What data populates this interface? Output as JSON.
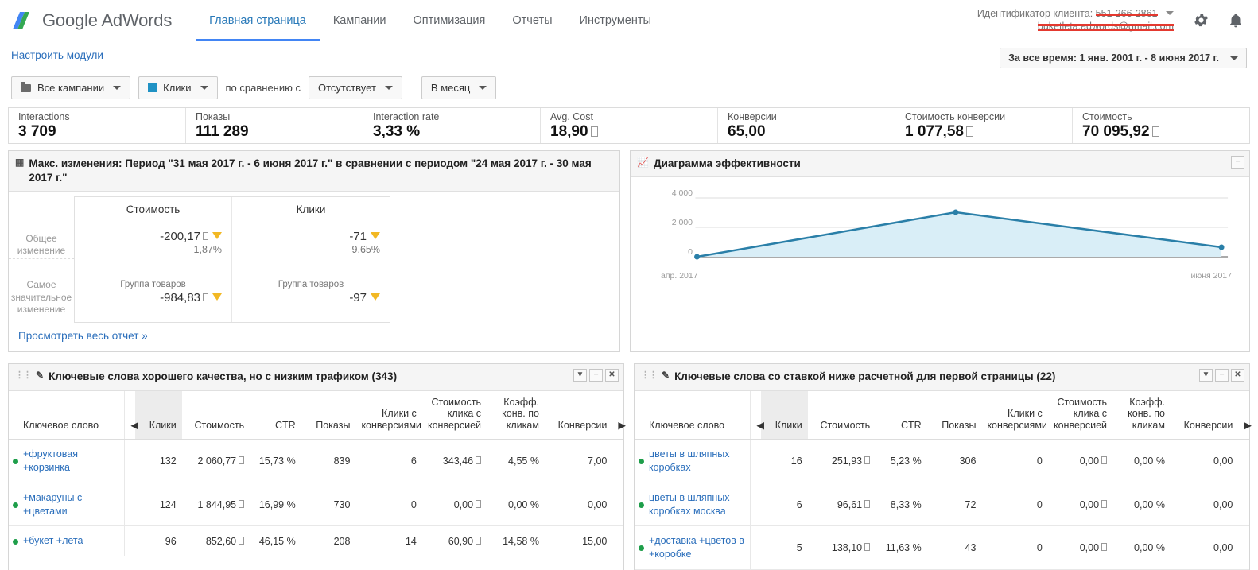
{
  "header": {
    "brand": "Google AdWords",
    "brand_google": "Google",
    "brand_adwords": "AdWords",
    "nav": [
      {
        "label": "Главная страница",
        "active": true
      },
      {
        "label": "Кампании",
        "active": false
      },
      {
        "label": "Оптимизация",
        "active": false
      },
      {
        "label": "Отчеты",
        "active": false
      },
      {
        "label": "Инструменты",
        "active": false
      }
    ],
    "client_label": "Идентификатор клиента:",
    "client_id": "551-266-2861",
    "client_email": "buketleta.adwords@gmail.com",
    "gear_icon": "gear-icon",
    "bell_icon": "bell-icon"
  },
  "subbar": {
    "configure_modules": "Настроить модули",
    "date_range": "За все время: 1 янв. 2001 г. - 8 июня 2017 г."
  },
  "filters": {
    "campaigns": "Все кампании",
    "metric": "Клики",
    "metric_color": "#2092c4",
    "compare_label": "по сравнению с",
    "compare_value": "Отсутствует",
    "period": "В месяц"
  },
  "stats": [
    {
      "label": "Interactions",
      "value": "3 709",
      "currency": false
    },
    {
      "label": "Показы",
      "value": "111 289",
      "currency": false
    },
    {
      "label": "Interaction rate",
      "value": "3,33 %",
      "currency": false
    },
    {
      "label": "Avg. Cost",
      "value": "18,90",
      "currency": true
    },
    {
      "label": "Конверсии",
      "value": "65,00",
      "currency": false
    },
    {
      "label": "Стоимость конверсии",
      "value": "1 077,58",
      "currency": true
    },
    {
      "label": "Стоимость",
      "value": "70 095,92",
      "currency": true
    }
  ],
  "max_changes": {
    "title": "Макс. изменения: Период \"31 мая 2017 г. - 6 июня 2017 г.\" в сравнении с периодом \"24 мая 2017 г. - 30 мая 2017 г.\"",
    "icon": "table-icon",
    "row_labels": [
      "Общее изменение",
      "Самое значительное изменение"
    ],
    "columns": [
      {
        "header": "Стоимость",
        "total_value": "-200,17",
        "total_currency": true,
        "total_pct": "-1,87%",
        "top_label": "Группа товаров",
        "top_value": "-984,83",
        "top_currency": true,
        "arrow": "down-arrow-icon"
      },
      {
        "header": "Клики",
        "total_value": "-71",
        "total_currency": false,
        "total_pct": "-9,65%",
        "top_label": "Группа товаров",
        "top_value": "-97",
        "top_currency": false,
        "arrow": "down-arrow-icon"
      }
    ],
    "full_report_link": "Просмотреть весь отчет »"
  },
  "chart_widget": {
    "title": "Диаграмма эффективности",
    "icon": "line-chart-icon",
    "minimize": "−"
  },
  "chart_data": {
    "type": "area",
    "title": "Диаграмма эффективности",
    "xlabel": "",
    "ylabel": "",
    "x": [
      "апр. 2017",
      "май 2017",
      "июня 2017"
    ],
    "tick_labels_shown": [
      "апр. 2017",
      "июня 2017"
    ],
    "values": [
      0,
      3050,
      650
    ],
    "ylim": [
      0,
      4000
    ],
    "yticks": [
      0,
      2000,
      4000
    ],
    "ytick_labels": [
      "0",
      "2 000",
      "4 000"
    ],
    "grid": true,
    "legend": "none",
    "line_color": "#2a7fa8",
    "fill_color": "#d9eef7",
    "series": [
      {
        "name": "Клики",
        "values": [
          0,
          3050,
          650
        ]
      }
    ]
  },
  "table_left": {
    "title": "Ключевые слова хорошего качества, но с низким трафиком (343)",
    "icon": "pencil-icon",
    "grip_icon": "drag-grip-icon",
    "controls": [
      "dropdown-icon",
      "minimize-icon",
      "close-icon"
    ],
    "columns": [
      "Ключевое слово",
      "Клики",
      "Стоимость",
      "CTR",
      "Показы",
      "Клики с конверсиями",
      "Стоимость клика с конверсией",
      "Коэфф. конв. по кликам",
      "Конверсии"
    ],
    "sorted_column": "Клики",
    "rows": [
      {
        "keyword": "+фруктовая +корзинка",
        "clicks": "132",
        "cost": "2 060,77",
        "ctr": "15,73 %",
        "impressions": "839",
        "conv_clicks": "6",
        "cost_per_conv": "343,46",
        "conv_rate": "4,55 %",
        "conversions": "7,00"
      },
      {
        "keyword": "+макаруны с +цветами",
        "clicks": "124",
        "cost": "1 844,95",
        "ctr": "16,99 %",
        "impressions": "730",
        "conv_clicks": "0",
        "cost_per_conv": "0,00",
        "conv_rate": "0,00 %",
        "conversions": "0,00"
      },
      {
        "keyword": "+букет +лета",
        "clicks": "96",
        "cost": "852,60",
        "ctr": "46,15 %",
        "impressions": "208",
        "conv_clicks": "14",
        "cost_per_conv": "60,90",
        "conv_rate": "14,58 %",
        "conversions": "15,00"
      }
    ]
  },
  "table_right": {
    "title": "Ключевые слова со ставкой ниже расчетной для первой страницы (22)",
    "icon": "pencil-icon",
    "grip_icon": "drag-grip-icon",
    "controls": [
      "dropdown-icon",
      "minimize-icon",
      "close-icon"
    ],
    "columns": [
      "Ключевое слово",
      "Клики",
      "Стоимость",
      "CTR",
      "Показы",
      "Клики с конверсиями",
      "Стоимость клика с конверсией",
      "Коэфф. конв. по кликам",
      "Конверсии"
    ],
    "sorted_column": "Клики",
    "rows": [
      {
        "keyword": "цветы в шляпных коробках",
        "clicks": "16",
        "cost": "251,93",
        "ctr": "5,23 %",
        "impressions": "306",
        "conv_clicks": "0",
        "cost_per_conv": "0,00",
        "conv_rate": "0,00 %",
        "conversions": "0,00"
      },
      {
        "keyword": "цветы в шляпных коробках москва",
        "clicks": "6",
        "cost": "96,61",
        "ctr": "8,33 %",
        "impressions": "72",
        "conv_clicks": "0",
        "cost_per_conv": "0,00",
        "conv_rate": "0,00 %",
        "conversions": "0,00"
      },
      {
        "keyword": "+доставка +цветов в +коробке",
        "clicks": "5",
        "cost": "138,10",
        "ctr": "11,63 %",
        "impressions": "43",
        "conv_clicks": "0",
        "cost_per_conv": "0,00",
        "conv_rate": "0,00 %",
        "conversions": "0,00"
      }
    ]
  }
}
